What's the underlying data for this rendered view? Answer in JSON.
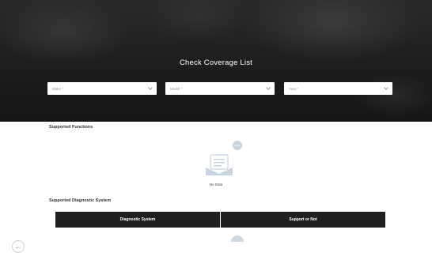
{
  "header": {
    "title": "Check Coverage List"
  },
  "filters": {
    "make_placeholder": "Make *",
    "model_placeholder": "Model *",
    "year_placeholder": "Year *"
  },
  "supported_functions": {
    "title": "Supported Functions",
    "empty_text": "No Data"
  },
  "supported_diagnostic_system": {
    "title": "Supported Diagnostic System",
    "columns": [
      "Diagnostic System",
      "Support or Not"
    ]
  },
  "icons": {
    "empty_state": "empty-document-icon",
    "back": "arrow-left-icon"
  },
  "colors": {
    "hero_background": "#1c1c1c",
    "table_header": "#1f1f1f",
    "illustration": "#c8d3e0"
  },
  "back_glyph": "←"
}
